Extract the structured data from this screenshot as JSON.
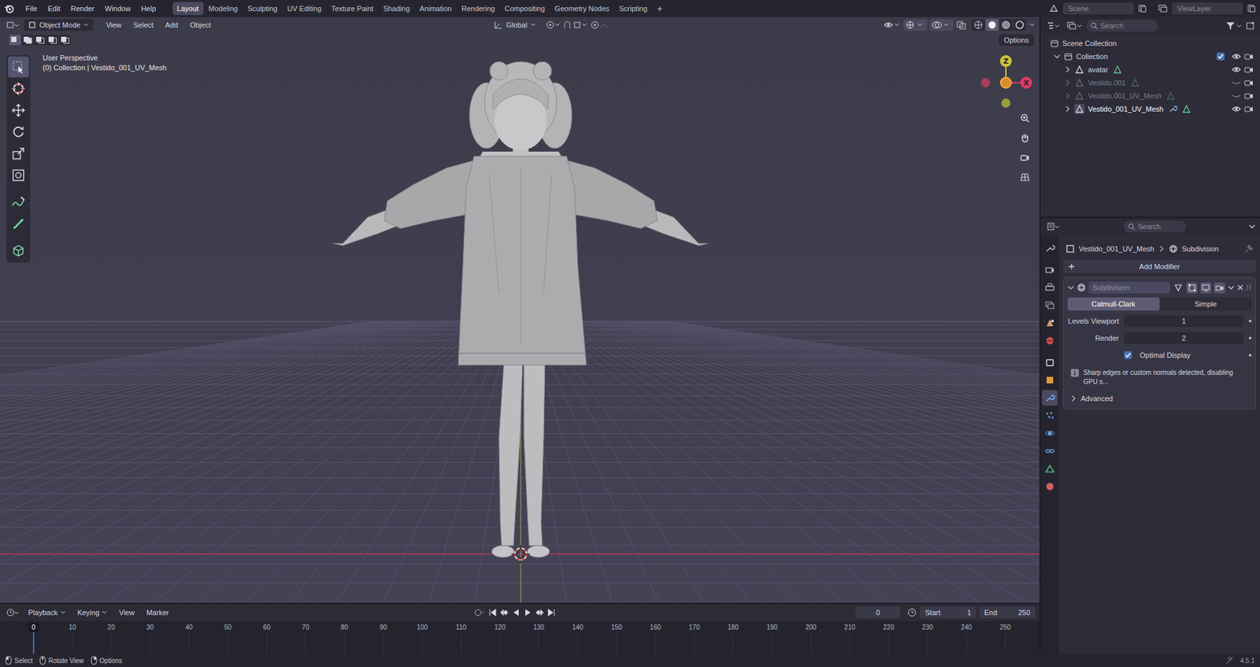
{
  "topbar": {
    "menus": [
      "File",
      "Edit",
      "Render",
      "Window",
      "Help"
    ],
    "workspaces": [
      {
        "label": "Layout",
        "selected": true
      },
      {
        "label": "Modeling",
        "selected": false
      },
      {
        "label": "Sculpting",
        "selected": false
      },
      {
        "label": "UV Editing",
        "selected": false
      },
      {
        "label": "Texture Paint",
        "selected": false
      },
      {
        "label": "Shading",
        "selected": false
      },
      {
        "label": "Animation",
        "selected": false
      },
      {
        "label": "Rendering",
        "selected": false
      },
      {
        "label": "Compositing",
        "selected": false
      },
      {
        "label": "Geometry Nodes",
        "selected": false
      },
      {
        "label": "Scripting",
        "selected": false
      }
    ],
    "add_workspace": "+",
    "scene": "Scene",
    "view_layer": "ViewLayer"
  },
  "viewport": {
    "mode": "Object Mode",
    "menus": [
      "View",
      "Select",
      "Add",
      "Object"
    ],
    "orientation": "Global",
    "options": "Options",
    "overlay_lines": [
      "User Perspective",
      "(0) Collection | Vestido_001_UV_Mesh"
    ],
    "select_modes": [
      {
        "kind": "set",
        "selected": true
      },
      {
        "kind": "extend",
        "selected": false
      },
      {
        "kind": "subtract",
        "selected": false
      },
      {
        "kind": "invert",
        "selected": false
      },
      {
        "kind": "intersect",
        "selected": false
      }
    ],
    "tools": [
      {
        "kind": "select",
        "selected": true
      },
      {
        "kind": "cursor",
        "selected": false
      },
      {
        "kind": "move",
        "selected": false
      },
      {
        "kind": "rotate",
        "selected": false
      },
      {
        "kind": "scale",
        "selected": false
      },
      {
        "kind": "transform",
        "selected": false
      },
      {
        "kind": "annotate",
        "selected": false
      },
      {
        "kind": "measure",
        "selected": false
      },
      {
        "kind": "add-cube",
        "selected": false
      }
    ],
    "shading": [
      {
        "kind": "wireframe",
        "selected": false
      },
      {
        "kind": "solid",
        "selected": true
      },
      {
        "kind": "material",
        "selected": false
      },
      {
        "kind": "rendered",
        "selected": false
      }
    ],
    "gizmo": {
      "z": "Z",
      "x": "X"
    }
  },
  "outliner": {
    "search": "Search",
    "root": "Scene Collection",
    "collection": {
      "name": "Collection",
      "checked": true,
      "expanded": true
    },
    "items": [
      {
        "name": "avatar",
        "visible": true,
        "active": false,
        "has_modifier": false
      },
      {
        "name": "Vestido.001",
        "visible": false,
        "active": false,
        "has_modifier": false
      },
      {
        "name": "Vestido.001_UV_Mesh",
        "visible": false,
        "active": false,
        "has_modifier": false
      },
      {
        "name": "Vestido_001_UV_Mesh",
        "visible": true,
        "active": true,
        "has_modifier": true
      }
    ]
  },
  "properties": {
    "search": "Search",
    "breadcrumb": {
      "object": "Vestido_001_UV_Mesh",
      "modifier": "Subdivision"
    },
    "tabs": [
      {
        "kind": "tool",
        "selected": false
      },
      {
        "kind": "render",
        "selected": false
      },
      {
        "kind": "output",
        "selected": false
      },
      {
        "kind": "view-layer",
        "selected": false
      },
      {
        "kind": "scene",
        "selected": false
      },
      {
        "kind": "world",
        "selected": false
      },
      {
        "kind": "collection",
        "selected": false
      },
      {
        "kind": "object",
        "selected": false
      },
      {
        "kind": "modifiers",
        "selected": true
      },
      {
        "kind": "particles",
        "selected": false
      },
      {
        "kind": "physics",
        "selected": false
      },
      {
        "kind": "constraints",
        "selected": false
      },
      {
        "kind": "data",
        "selected": false
      },
      {
        "kind": "material",
        "selected": false
      }
    ],
    "add_modifier": "Add Modifier",
    "modifier": {
      "name": "Subdivision",
      "expanded": true,
      "toggles": [
        {
          "kind": "on-cage",
          "on": false
        },
        {
          "kind": "edit-mode",
          "on": true
        },
        {
          "kind": "viewport",
          "on": true
        },
        {
          "kind": "render",
          "on": true
        }
      ],
      "methods": [
        {
          "label": "Catmull-Clark",
          "selected": true
        },
        {
          "label": "Simple",
          "selected": false
        }
      ],
      "fields": [
        {
          "label": "Levels Viewport",
          "value": "1"
        },
        {
          "label": "Render",
          "value": "2"
        }
      ],
      "optimal_display": {
        "label": "Optimal Display",
        "checked": true
      },
      "info": "Sharp edges or custom normals detected, disabling GPU s...",
      "advanced": {
        "label": "Advanced",
        "expanded": false
      }
    }
  },
  "timeline": {
    "menus": [
      "Playback",
      "Keying",
      "View",
      "Marker"
    ],
    "current_frame": "0",
    "start_label": "Start",
    "start": "1",
    "end_label": "End",
    "end": "250",
    "playhead": "0",
    "ticks": [
      "10",
      "20",
      "30",
      "40",
      "50",
      "60",
      "70",
      "80",
      "90",
      "100",
      "110",
      "120",
      "130",
      "140",
      "150",
      "160",
      "170",
      "180",
      "190",
      "200",
      "210",
      "220",
      "230",
      "240",
      "250"
    ]
  },
  "status_bar": {
    "hints": [
      "Select",
      "Rotate View",
      "Options"
    ],
    "version": "4.5.1"
  }
}
